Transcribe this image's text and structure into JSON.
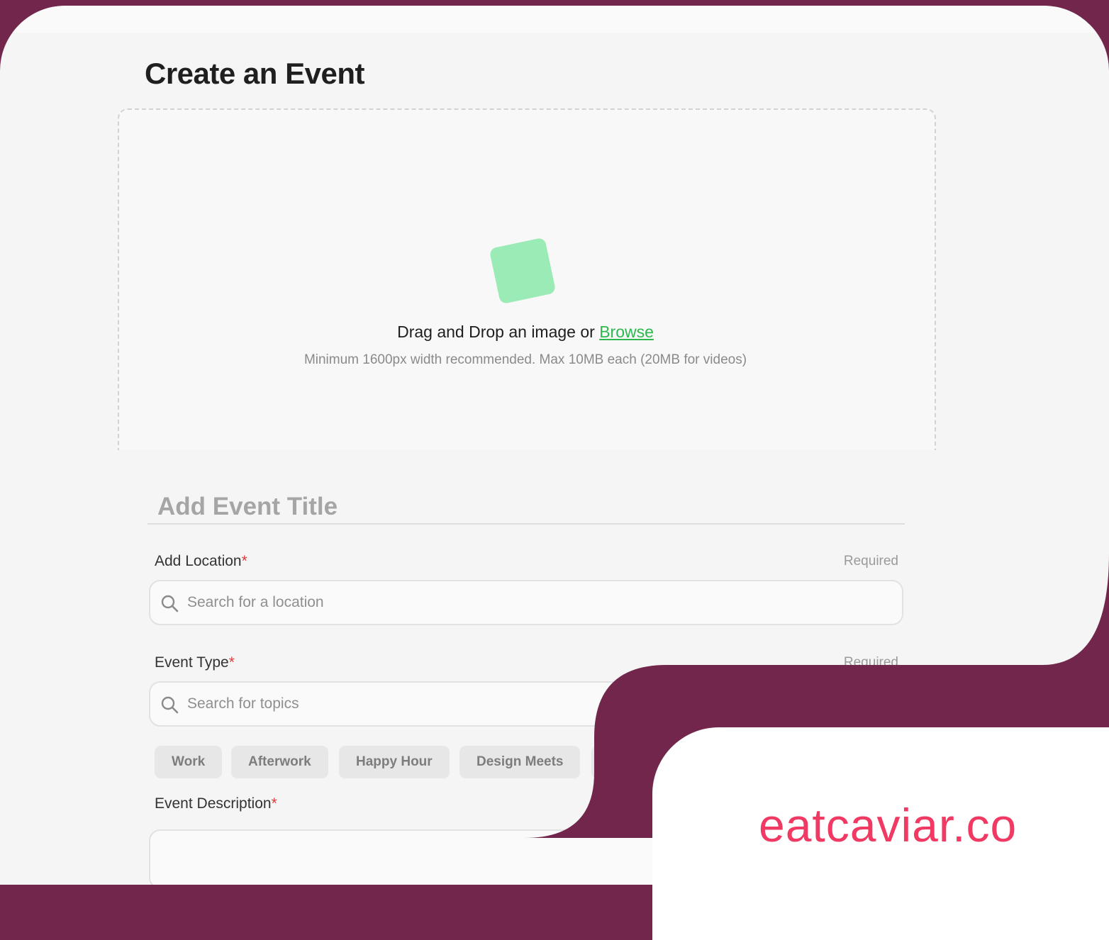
{
  "form": {
    "title": "Create an Event",
    "upload": {
      "prompt": "Drag and Drop an image or ",
      "browse_label": "Browse",
      "hint": "Minimum 1600px width recommended. Max 10MB each (20MB for videos)"
    },
    "event_title_placeholder": "Add Event Title",
    "location": {
      "label": "Add Location",
      "required_marker": "*",
      "note": "Required",
      "placeholder": "Search for a location"
    },
    "event_type": {
      "label": "Event Type",
      "required_marker": "*",
      "note": "Required",
      "placeholder": "Search for topics",
      "chips": [
        "Work",
        "Afterwork",
        "Happy Hour",
        "Design Meets"
      ]
    },
    "description": {
      "label": "Event Description",
      "required_marker": "*"
    }
  },
  "brand": {
    "name": "eatcaviar.co",
    "color": "#f03a63"
  },
  "colors": {
    "background": "#72264b",
    "accent_green": "#2db84d",
    "upload_icon": "#9bebb6",
    "required_star": "#e03939"
  },
  "icons": [
    "image-upload-icon",
    "search-icon"
  ]
}
